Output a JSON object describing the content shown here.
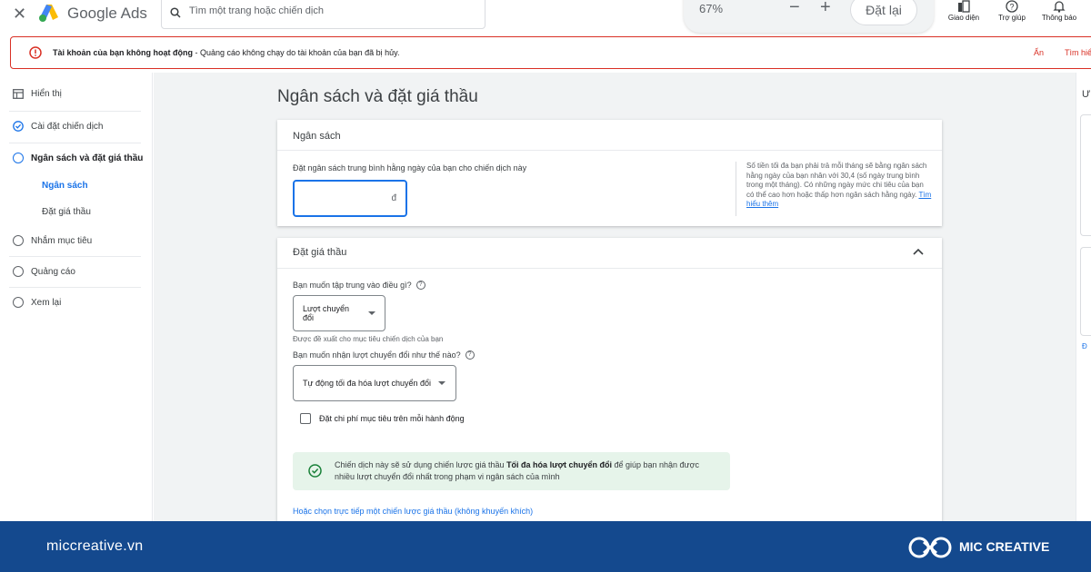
{
  "topbar": {
    "close_icon": "close-icon",
    "brand_name": "Google Ads",
    "search_placeholder": "Tìm một trang hoặc chiến dịch",
    "zoom_value": "67%",
    "zoom_minus": "−",
    "zoom_plus": "+",
    "reset_label": "Đặt lại",
    "icons": [
      {
        "label": "Giao diện",
        "icon": "appearance-icon"
      },
      {
        "label": "Trợ giúp",
        "icon": "help-icon"
      },
      {
        "label": "Thông báo",
        "icon": "bell-icon"
      }
    ]
  },
  "alert": {
    "title": "Tài khoản của bạn không hoạt động",
    "message": " - Quảng cáo không chạy do tài khoản của bạn đã bị hủy.",
    "hide_label": "Ẩn",
    "learn_label": "Tìm hiể"
  },
  "nav": {
    "items": [
      {
        "label": "Hiển thị"
      },
      {
        "label": "Cài đặt chiến dịch"
      },
      {
        "label": "Ngân sách và đặt giá thầu"
      },
      {
        "label": "Nhắm mục tiêu"
      },
      {
        "label": "Quảng cáo"
      },
      {
        "label": "Xem lại"
      }
    ],
    "sub_items": [
      {
        "label": "Ngân sách"
      },
      {
        "label": "Đặt giá thầu"
      }
    ]
  },
  "main": {
    "page_title": "Ngân sách và đặt giá thầu",
    "budget": {
      "header": "Ngân sách",
      "label": "Đặt ngân sách trung bình hằng ngày của bạn cho chiến dịch này",
      "input_value": "",
      "currency": "đ",
      "info_text": "Số tiền tối đa bạn phải trả mỗi tháng sẽ bằng ngân sách hằng ngày của bạn nhân với 30,4 (số ngày trung bình trong một tháng). Có những ngày mức chi tiêu của bạn có thể cao hơn hoặc thấp hơn ngân sách hằng ngày. ",
      "info_link": "Tìm hiểu thêm"
    },
    "bidding": {
      "header": "Đặt giá thầu",
      "q1_label": "Bạn muốn tập trung vào điều gì?",
      "q1_value": "Lượt chuyển đổi",
      "q1_hint": "Được đề xuất cho mục tiêu chiến dịch của bạn",
      "q2_label": "Bạn muốn nhận lượt chuyển đổi như thế nào?",
      "q2_value": "Tự động tối đa hóa lượt chuyển đổi",
      "checkbox_label": "Đặt chi phí mục tiêu trên mỗi hành động",
      "notice_prefix": "Chiến dịch này sẽ sử dụng chiến lược giá thầu ",
      "notice_bold": "Tối đa hóa lượt chuyển đổi",
      "notice_suffix": " để giúp bạn nhận được nhiều lượt chuyển đổi nhất trong phạm vi ngân sách của mình",
      "manual_link": "Hoặc chọn trực tiếp một chiến lược giá thầu (không khuyến khích)"
    }
  },
  "right_pane": {
    "title": "Ư",
    "link": "Đ"
  },
  "footer": {
    "site": "miccreative.vn",
    "brand": "MIC CREATIVE"
  },
  "colors": {
    "accent": "#1a73e8",
    "error": "#d93025",
    "success_bg": "#e6f4ea",
    "footer_bg": "#14498e"
  }
}
